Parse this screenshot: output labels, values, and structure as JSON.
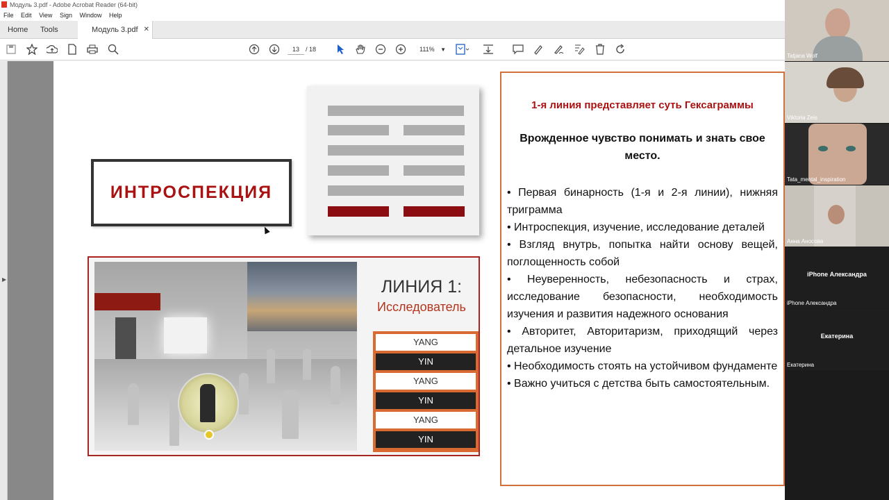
{
  "window": {
    "title": "Модуль 3.pdf - Adobe Acrobat Reader (64-bit)"
  },
  "menu": [
    "File",
    "Edit",
    "View",
    "Sign",
    "Window",
    "Help"
  ],
  "tabs": {
    "home": "Home",
    "tools": "Tools",
    "doc": "Модуль 3.pdf",
    "close": "✕"
  },
  "toolbar": {
    "page_current": "13",
    "page_total": "/ 18",
    "zoom": "111%",
    "icons": [
      "save-icon",
      "star-icon",
      "upload-icon",
      "document-icon",
      "print-icon",
      "search-icon",
      "page-up-icon",
      "page-down-icon",
      "select-cursor-icon",
      "hand-icon",
      "zoom-out-icon",
      "zoom-in-icon",
      "fit-page-icon",
      "scroll-mode-icon",
      "comment-icon",
      "highlight-pen-icon",
      "sign-icon",
      "edit-icon",
      "delete-icon",
      "rotate-icon"
    ]
  },
  "slide": {
    "title": "ИНТРОСПЕКЦИЯ",
    "line_title": "ЛИНИЯ 1:",
    "line_subtitle": "Исследователь",
    "hexagram_lines": [
      "yang",
      "yin",
      "yang",
      "yin",
      "yang",
      "yin-red"
    ],
    "yin_yang": [
      "YANG",
      "YIN",
      "YANG",
      "YIN",
      "YANG",
      "YIN"
    ],
    "text_header": "1-я линия представляет суть Гексаграммы",
    "text_sub": "Врожденное чувство понимать и знать свое место.",
    "bullets": [
      "•   Первая бинарность (1-я и 2-я линии), нижняя триграмма",
      "• Интроспекция, изучение, исследование деталей",
      "• Взгляд внутрь, попытка найти основу вещей, поглощенность собой",
      "• Неуверенность, небезопасность и страх, исследование безопасности, необходимость изучения и развития надежного основания",
      "• Авторитет, Авторитаризм, приходящий через детальное изучение",
      "• Необходимость стоять на устойчивом фундаменте",
      "•   Важно учиться с детства быть самостоятельным."
    ]
  },
  "participants": [
    {
      "name": "Tatjana Wolf",
      "bg": "#cfc9c0"
    },
    {
      "name": "Viktoria Zeis",
      "bg": "#d7d4ce"
    },
    {
      "name": "Tata_mental_inspiration",
      "bg": "#2a2a2a"
    },
    {
      "name": "Анна Аносова",
      "bg": "#c7c2ba"
    },
    {
      "name": "iPhone Александра",
      "center": "iPhone Александра",
      "bg": "#1e1e1e"
    },
    {
      "name": "Екатерина",
      "center": "Екатерина",
      "bg": "#1e1e1e"
    }
  ],
  "colors": {
    "accent_red": "#a11111",
    "orange": "#d96a32",
    "yin_black": "#222222"
  }
}
